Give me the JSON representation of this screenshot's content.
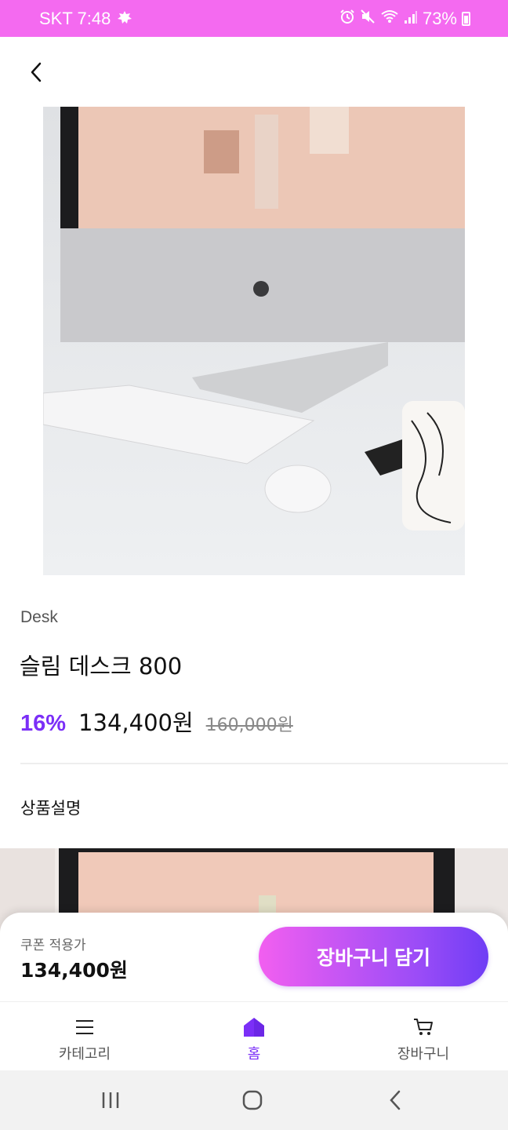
{
  "status_bar": {
    "carrier_time": "SKT 7:48",
    "battery": "73%"
  },
  "product": {
    "category": "Desk",
    "title": "슬림 데스크 800",
    "discount_rate": "16%",
    "sale_price": "134,400원",
    "original_price": "160,000원"
  },
  "description": {
    "title": "상품설명"
  },
  "purchase_bar": {
    "coupon_label": "쿠폰 적용가",
    "coupon_price": "134,400원",
    "add_to_cart_label": "장바구니 담기"
  },
  "tab_bar": {
    "tabs": [
      {
        "label": "카테고리",
        "icon": "menu-icon"
      },
      {
        "label": "홈",
        "icon": "home-icon",
        "active": true
      },
      {
        "label": "장바구니",
        "icon": "cart-icon"
      }
    ]
  },
  "colors": {
    "status_bar": "#f46af0",
    "accent": "#7b2ff7",
    "button_start": "#f25ff0",
    "button_end": "#6f3df5"
  }
}
